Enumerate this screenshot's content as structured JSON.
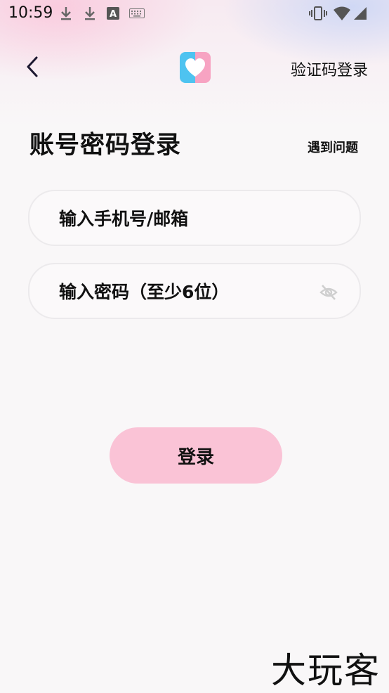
{
  "status_bar": {
    "time": "10:59",
    "icons": [
      "download-icon",
      "download-icon",
      "font-a-icon",
      "keyboard-icon",
      "vibrate-icon",
      "wifi-icon",
      "signal-icon"
    ]
  },
  "header": {
    "back_icon": "chevron-left-icon",
    "logo_icon": "heart-logo-icon",
    "switch_login_label": "验证码登录"
  },
  "page": {
    "title": "账号密码登录",
    "help_link": "遇到问题"
  },
  "form": {
    "account_placeholder": "输入手机号/邮箱",
    "account_value": "",
    "password_placeholder": "输入密码（至少6位）",
    "password_value": "",
    "password_visibility_icon": "eye-off-icon"
  },
  "login_button_label": "登录",
  "watermark": "大玩客",
  "colors": {
    "login_button": "#fac3d6",
    "logo_blue": "#4ec3f0",
    "logo_pink": "#f7a3c2"
  }
}
